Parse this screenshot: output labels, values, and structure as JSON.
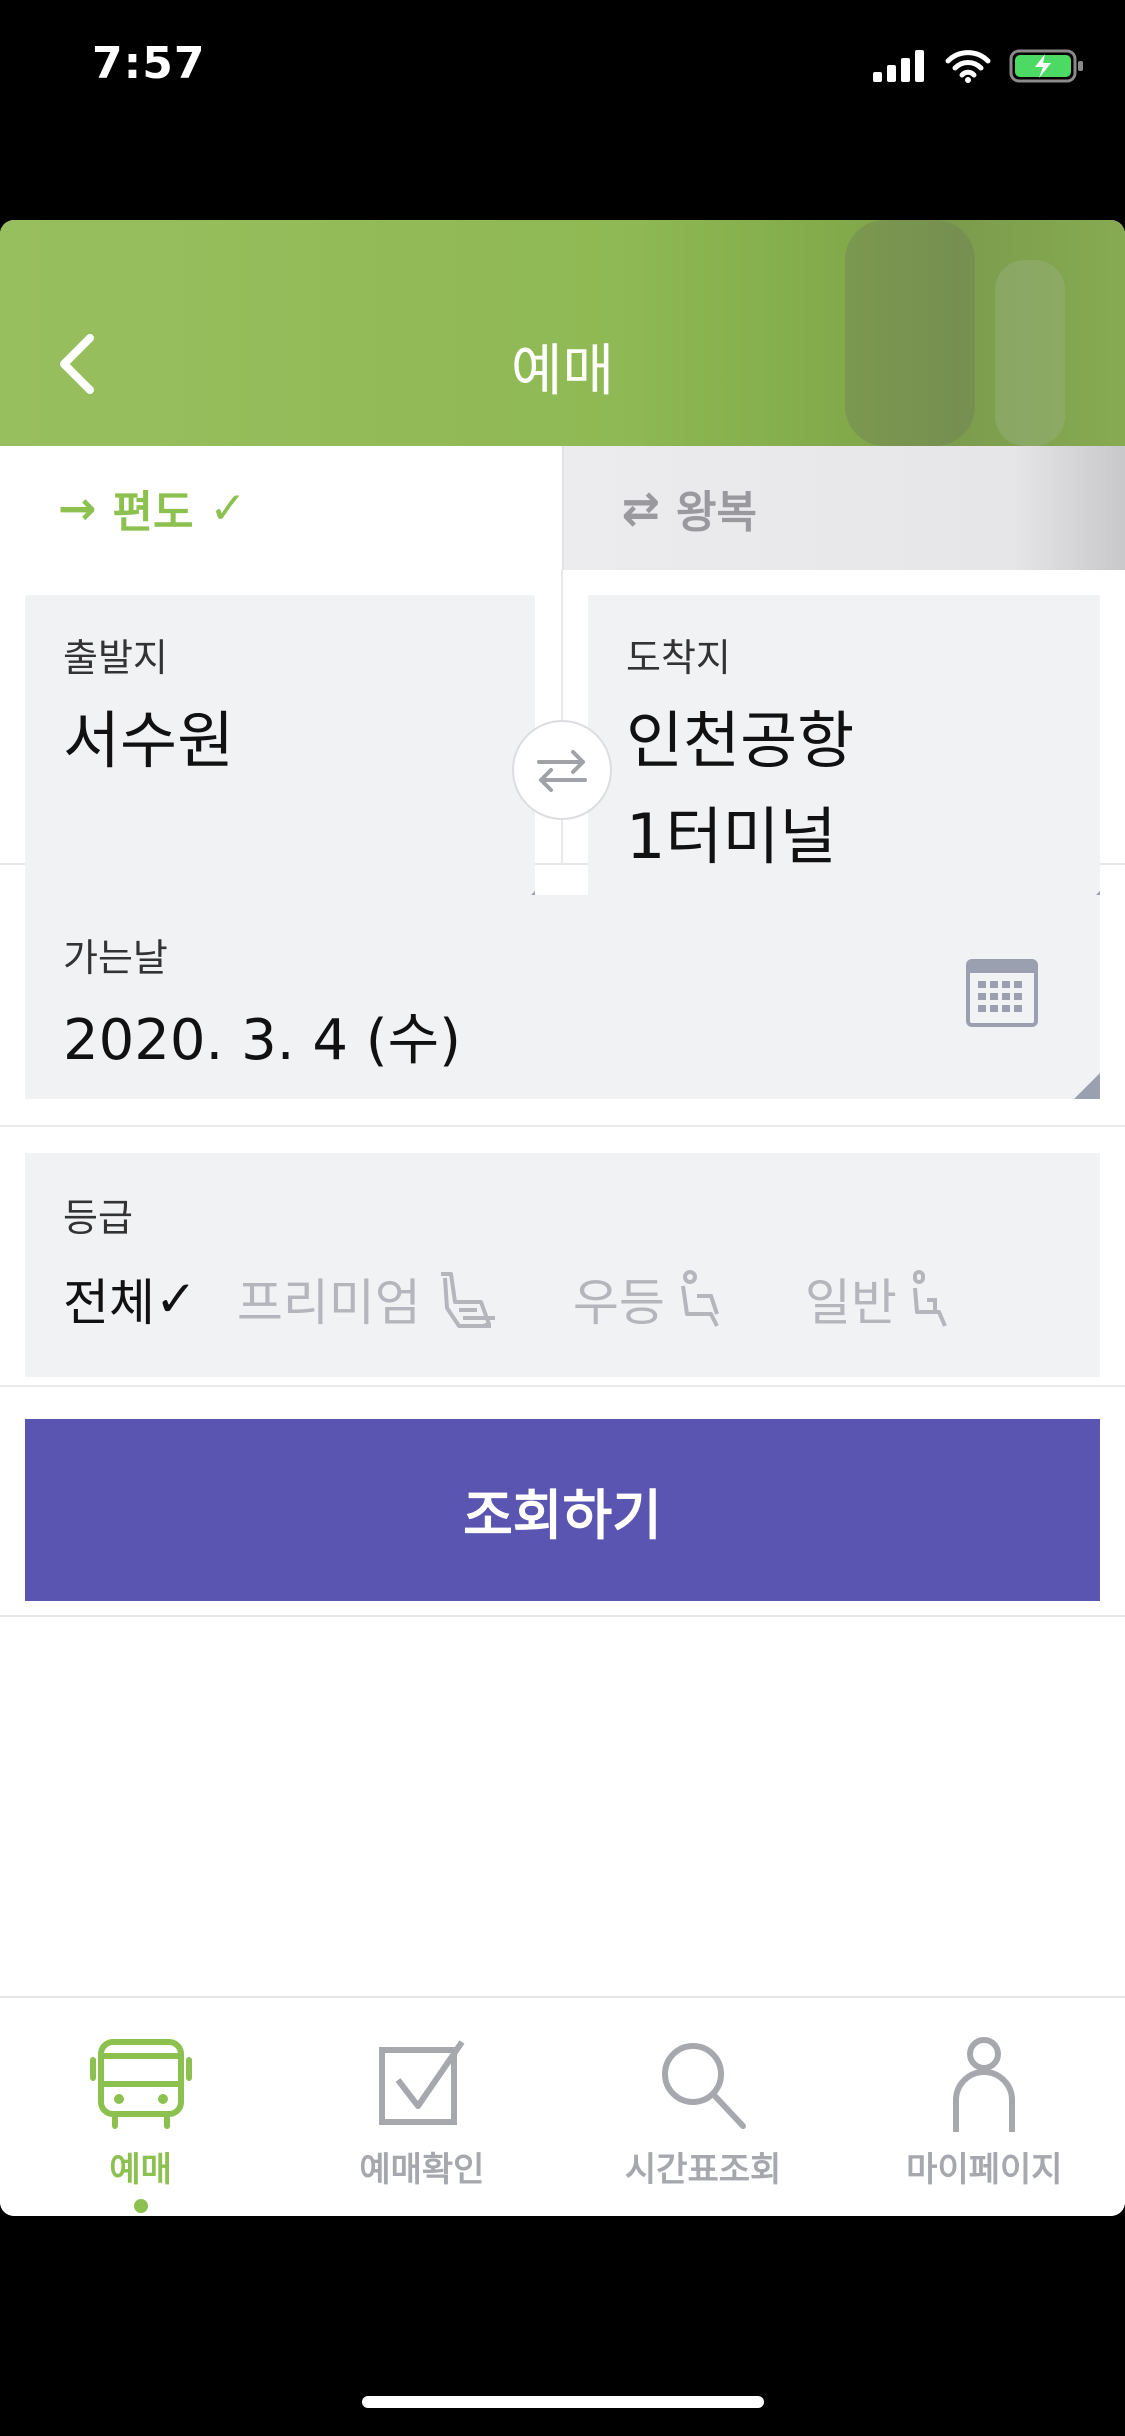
{
  "status_bar": {
    "time": "7:57"
  },
  "header": {
    "title": "예매",
    "back_icon": "chevron-left-icon"
  },
  "trip_type": {
    "oneway": {
      "label": "편도",
      "check": "✓",
      "selected": true
    },
    "roundtrip": {
      "label": "왕복",
      "selected": false
    }
  },
  "departure": {
    "label": "출발지",
    "value": "서수원"
  },
  "arrival": {
    "label": "도착지",
    "value_line1": "인천공항",
    "value_line2": "1터미널"
  },
  "date": {
    "label": "가는날",
    "value": "2020. 3. 4 (수)"
  },
  "grade": {
    "label": "등급",
    "options": [
      {
        "label": "전체",
        "check": "✓",
        "selected": true
      },
      {
        "label": "프리미엄",
        "selected": false
      },
      {
        "label": "우등",
        "selected": false
      },
      {
        "label": "일반",
        "selected": false
      }
    ]
  },
  "search_button": {
    "label": "조회하기"
  },
  "tabbar": {
    "items": [
      {
        "label": "예매",
        "icon": "bus-icon",
        "active": true
      },
      {
        "label": "예매확인",
        "icon": "checkbox-icon",
        "active": false
      },
      {
        "label": "시간표조회",
        "icon": "search-icon",
        "active": false
      },
      {
        "label": "마이페이지",
        "icon": "person-icon",
        "active": false
      }
    ]
  },
  "colors": {
    "accent_green": "#8cc04f",
    "button_purple": "#5955b0",
    "field_bg": "#f1f2f4",
    "inactive_gray": "#a6a8ae"
  }
}
